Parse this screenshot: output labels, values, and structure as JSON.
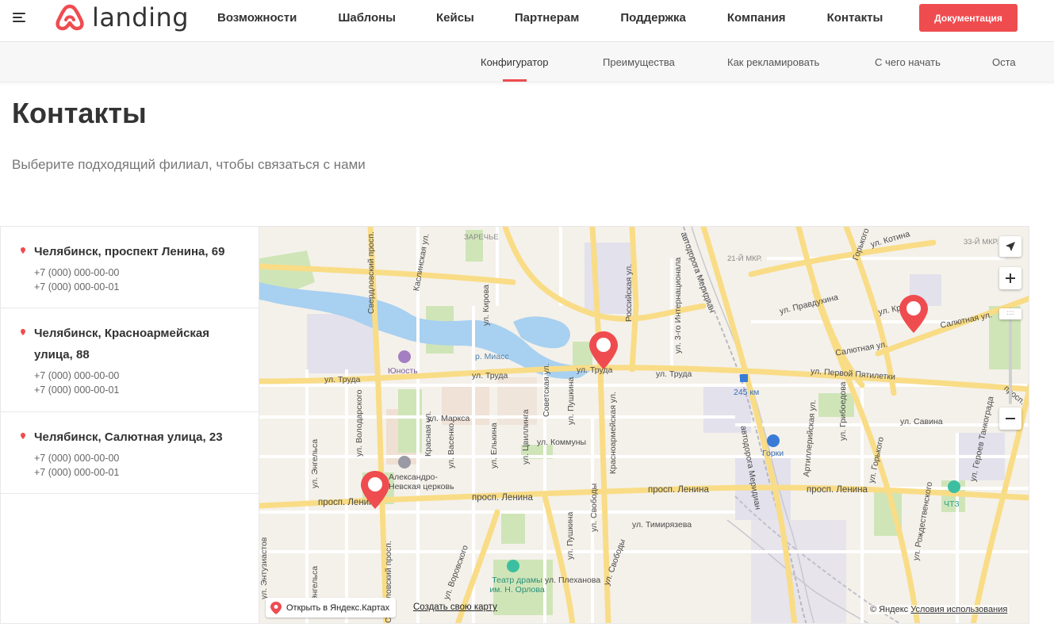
{
  "header": {
    "logo_text": "landing",
    "nav": [
      "Возможности",
      "Шаблоны",
      "Кейсы",
      "Партнерам",
      "Поддержка",
      "Компания",
      "Контакты"
    ],
    "docs_button": "Документация"
  },
  "subnav": {
    "items": [
      "Конфигуратор",
      "Преимущества",
      "Как рекламировать",
      "С чего начать",
      "Оста"
    ],
    "active": "Конфигуратор"
  },
  "page": {
    "title": "Контакты",
    "subtitle": "Выберите подходящий филиал, чтобы связаться с нами"
  },
  "branches": [
    {
      "name": "Челябинск, проспект Ленина, 69",
      "phones": [
        "+7 (000) 000-00-00",
        "+7 (000) 000-00-01"
      ]
    },
    {
      "name": "Челябинск, Красноармейская улица, 88",
      "phones": [
        "+7 (000) 000-00-00",
        "+7 (000) 000-00-01"
      ]
    },
    {
      "name": "Челябинск, Салютная улица, 23",
      "phones": [
        "+7 (000) 000-00-00",
        "+7 (000) 000-00-01"
      ]
    }
  ],
  "map": {
    "open_in_yandex": "Открыть в Яндекс.Картах",
    "create_map": "Создать свою карту",
    "copyright": "© Яндекс",
    "terms": "Условия использования",
    "labels": {
      "zarechye": "ЗАРЕЧЬЕ",
      "district21": "21-Й МКР.",
      "district33": "33-Й МКР.",
      "miass": "р. Миасс",
      "yunost": "Юность",
      "truda1": "ул. Труда",
      "truda2": "ул. Труда",
      "truda3": "ул. Труда",
      "truda4": "ул. Труда",
      "pervoy": "ул. Первой Пятилетки",
      "salyut1": "Салютная ул.",
      "salyut2": "Салютная ул.",
      "krylova": "ул. Крылова",
      "pravdukhina": "ул. Правдухина",
      "kotina": "ул. Котина",
      "savina": "ул. Савина",
      "marksa": "ул. Маркса",
      "kommuny": "ул. Коммуны",
      "lenina1": "просп. Ленина",
      "lenina2": "просп. Ленина",
      "lenina3": "просп. Ленина",
      "lenina4": "просп. Ленина",
      "timiryazeva": "ул. Тимирязева",
      "plekhanova": "ул. Плеханова",
      "station": "245 км",
      "gorki": "Горки",
      "chtz": "ЧТЗ",
      "church": "Александро-Невская церковь",
      "theatre": "Театр драмы им. Н. Орлова",
      "engelsa1": "ул. Энгельса",
      "engelsa2": "ул. Энгельса",
      "sverdlovsky1": "Свердловский просп.",
      "sverdlovsky2": "Свердловский просп.",
      "kirova": "ул. Кирова",
      "kaslinskaya": "Каслинская ул.",
      "rossiyskaya": "Российская ул.",
      "internatsionala": "ул. 3-го Интернационала",
      "meridian1": "автодорога Меридиан",
      "meridian2": "автодорога Меридиан",
      "krasnoarmeyskaya": "Красноармейская ул.",
      "svobody1": "ул. Свободы",
      "svobody2": "ул. Свободы",
      "sovetskaya": "Советская ул.",
      "pushkina1": "ул. Пушкина",
      "pushkina2": "ул. Пушкина",
      "tsvillinga": "ул. Цвиллинга",
      "yelkina": "ул. Елькина",
      "vasenko": "ул. Васенко",
      "krasnaya": "Красная ул.",
      "volodarskogo": "ул. Володарского",
      "vorovskogo": "ул. Воровского",
      "entuziastov": "ул. Энтузиастов",
      "artilleriyskaya": "Артиллерийская ул.",
      "griboedova": "ул. Грибоедова",
      "gorkogo1": "ул. Горького",
      "gorkogo2": "Горького",
      "tankograda": "ул. Героев Танкограда",
      "rozhdestvenskogo": "ул. Рождественского",
      "troitsky": "просп."
    }
  }
}
